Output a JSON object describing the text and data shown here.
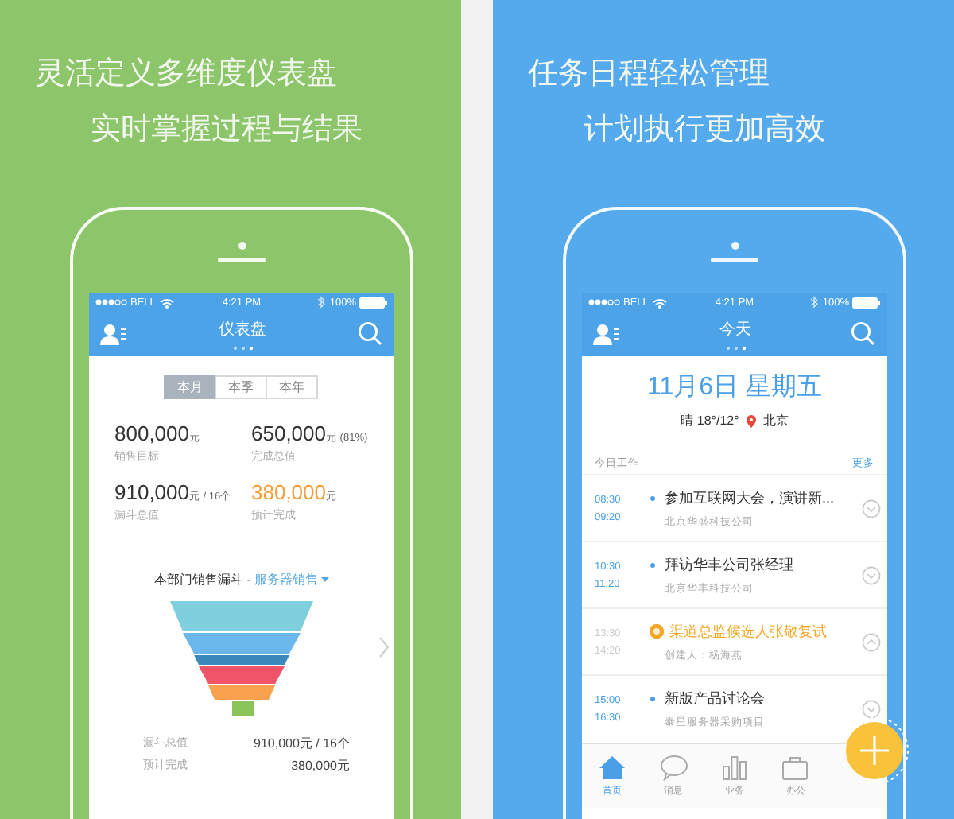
{
  "panels": [
    {
      "kind": "dashboard",
      "color": "#8dc66a",
      "captions": [
        "灵活定义多维度仪表盘",
        "实时掌握过程与结果"
      ],
      "status_bar": {
        "carrier": "BELL",
        "time": "4:21 PM",
        "battery": "100%"
      },
      "nav": {
        "title": "仪表盘"
      },
      "segments": [
        {
          "label": "本月",
          "selected": true
        },
        {
          "label": "本季",
          "selected": false
        },
        {
          "label": "本年",
          "selected": false
        }
      ],
      "stats": [
        {
          "value": "800,000",
          "unit": "元",
          "label": "销售目标",
          "highlight": false
        },
        {
          "value": "650,000",
          "unit": "元 (81%)",
          "label": "完成总值",
          "highlight": false
        },
        {
          "value": "910,000",
          "unit": "元 / 16个",
          "label": "漏斗总值",
          "highlight": false
        },
        {
          "value": "380,000",
          "unit": "元",
          "label": "预计完成",
          "highlight": true
        }
      ],
      "funnel": {
        "title": "本部门销售漏斗 - ",
        "filter": "服务器销售",
        "summary": [
          {
            "label": "漏斗总值",
            "value": "910,000元 / 16个"
          },
          {
            "label": "预计完成",
            "value": "380,000元"
          }
        ]
      }
    },
    {
      "kind": "today",
      "color": "#55aaee",
      "captions": [
        "任务日程轻松管理",
        "计划执行更加高效"
      ],
      "status_bar": {
        "carrier": "BELL",
        "time": "4:21 PM",
        "battery": "100%"
      },
      "nav": {
        "title": "今天"
      },
      "date": "11月6日 星期五",
      "weather": "晴 18°/12°",
      "city": "北京",
      "section": {
        "title": "今日工作",
        "more": "更多"
      },
      "events": [
        {
          "kind": "normal",
          "start": "08:30",
          "end": "09:20",
          "title": "参加互联网大会，演讲新...",
          "subtitle": "北京华盛科技公司",
          "expanded": false
        },
        {
          "kind": "normal",
          "start": "10:30",
          "end": "11:20",
          "title": "拜访华丰公司张经理",
          "subtitle": "北京华丰科技公司",
          "expanded": false
        },
        {
          "kind": "alert",
          "start": "13:30",
          "end": "14:20",
          "title": "渠道总监候选人张敬复试",
          "subtitle": "创建人：杨海燕",
          "expanded": true
        },
        {
          "kind": "normal",
          "start": "15:00",
          "end": "16:30",
          "title": "新版产品讨论会",
          "subtitle": "泰星服务器采购项目",
          "expanded": false
        }
      ],
      "tabs": [
        {
          "label": "首页",
          "selected": true
        },
        {
          "label": "消息",
          "selected": false
        },
        {
          "label": "业务",
          "selected": false
        },
        {
          "label": "办公",
          "selected": false
        }
      ]
    }
  ]
}
